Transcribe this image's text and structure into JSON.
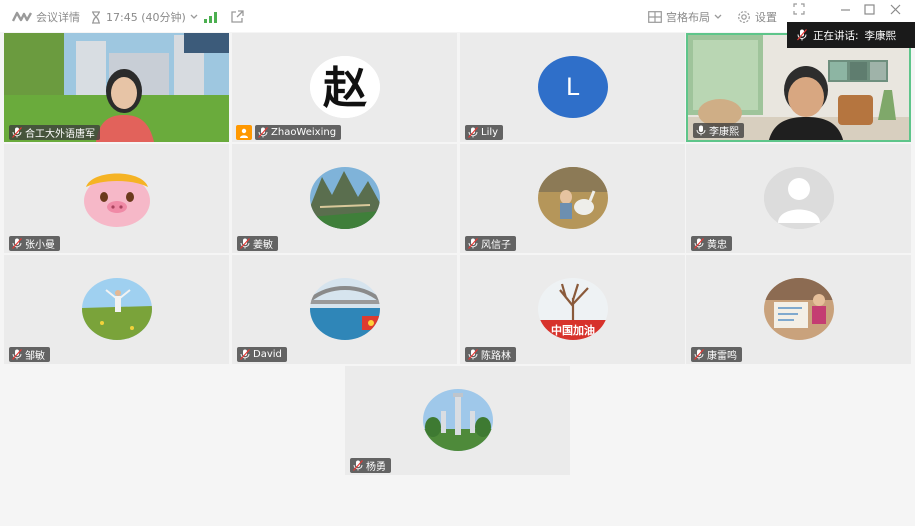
{
  "toolbar": {
    "meeting_details": "会议详情",
    "time": "17:45 (40分钟)",
    "layout": "宫格布局",
    "settings": "设置"
  },
  "speaking": {
    "label": "正在讲话:",
    "name": "李康熙"
  },
  "participants": [
    {
      "name": "合工大外语唐军",
      "avatar": "video-feed"
    },
    {
      "name": "ZhaoWeixing",
      "avatar": "calligraphy-zhao",
      "host": true
    },
    {
      "name": "Lily",
      "avatar": "letter",
      "letter": "L",
      "color": "#2f6fc9"
    },
    {
      "name": "李康熙",
      "avatar": "video-feed",
      "active": true
    },
    {
      "name": "张小曼",
      "avatar": "cartoon-pig"
    },
    {
      "name": "姜敏",
      "avatar": "mountain-photo"
    },
    {
      "name": "风信子",
      "avatar": "child-photo"
    },
    {
      "name": "黄忠",
      "avatar": "default-person"
    },
    {
      "name": "邹敏",
      "avatar": "field-photo"
    },
    {
      "name": "David",
      "avatar": "bridge-photo"
    },
    {
      "name": "陈路林",
      "avatar": "tree-photo"
    },
    {
      "name": "康雷鸣",
      "avatar": "child-drawing-photo"
    },
    {
      "name": "杨勇",
      "avatar": "tower-photo"
    }
  ],
  "avatar_texts": {
    "zhao_char": "赵",
    "china_banner": "中国加油"
  }
}
